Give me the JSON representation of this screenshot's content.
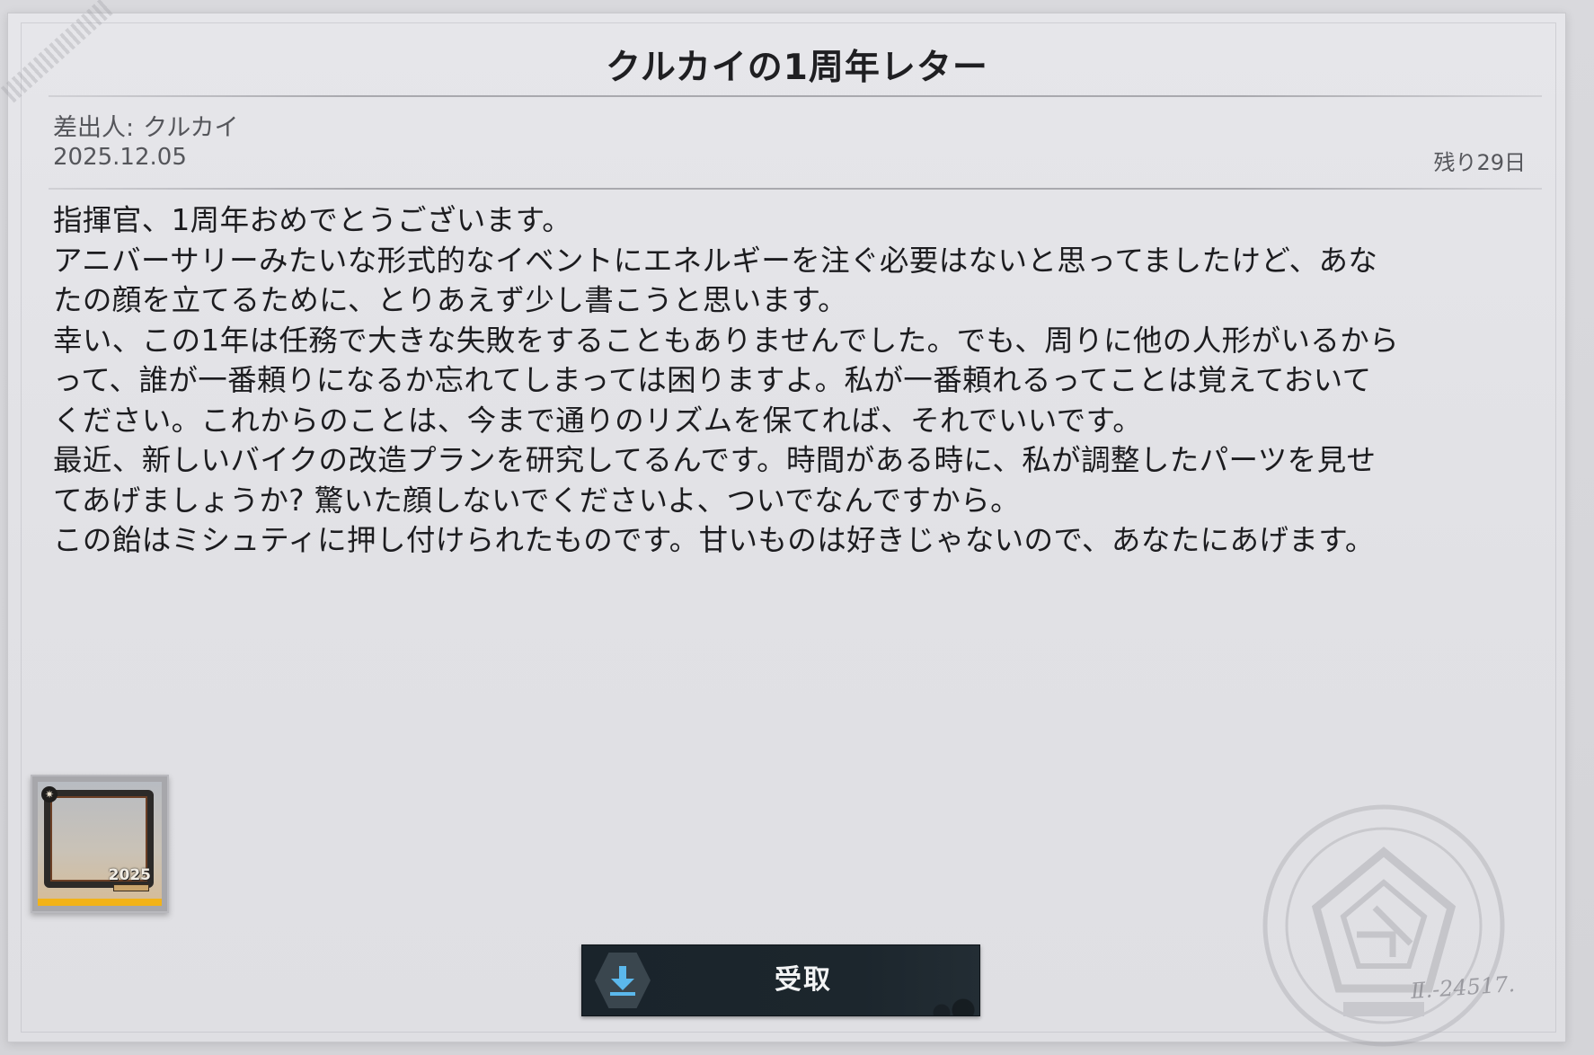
{
  "letter": {
    "title": "クルカイの1周年レター",
    "sender_label": "差出人:",
    "sender_name": "クルカイ",
    "date": "2025.12.05",
    "remaining": "残り29日",
    "body_lines": [
      "指揮官、1周年おめでとうございます。",
      "アニバーサリーみたいな形式的なイベントにエネルギーを注ぐ必要はないと思ってましたけど、あな",
      "たの顔を立てるために、とりあえず少し書こうと思います。",
      "幸い、この1年は任務で大きな失敗をすることもありませんでした。でも、周りに他の人形がいるから",
      "って、誰が一番頼りになるか忘れてしまっては困りますよ。私が一番頼れるってことは覚えておいて",
      "ください。これからのことは、今まで通りのリズムを保てれば、それでいいです。",
      "最近、新しいバイクの改造プランを研究してるんです。時間がある時に、私が調整したパーツを見せ",
      "てあげましょうか? 驚いた顔しないでくださいよ、ついでなんですから。",
      "この飴はミシュティに押し付けられたものです。甘いものは好きじゃないので、あなたにあげます。"
    ]
  },
  "attachment": {
    "icon": "anniversary-avatar-frame-icon",
    "year_text": "2025",
    "rarity_color": "#f2b318"
  },
  "claim_button": {
    "label": "受取",
    "icon": "download-icon",
    "icon_color": "#5bb8ec"
  },
  "stamp": {
    "icon": "faded-seal-stamp-icon",
    "signature": "Ⅱ.-24517."
  },
  "colors": {
    "paper": "#e3e3e7",
    "button_bg": "#1c262d",
    "text": "#1c1c1f",
    "meta_text": "#55565b"
  }
}
